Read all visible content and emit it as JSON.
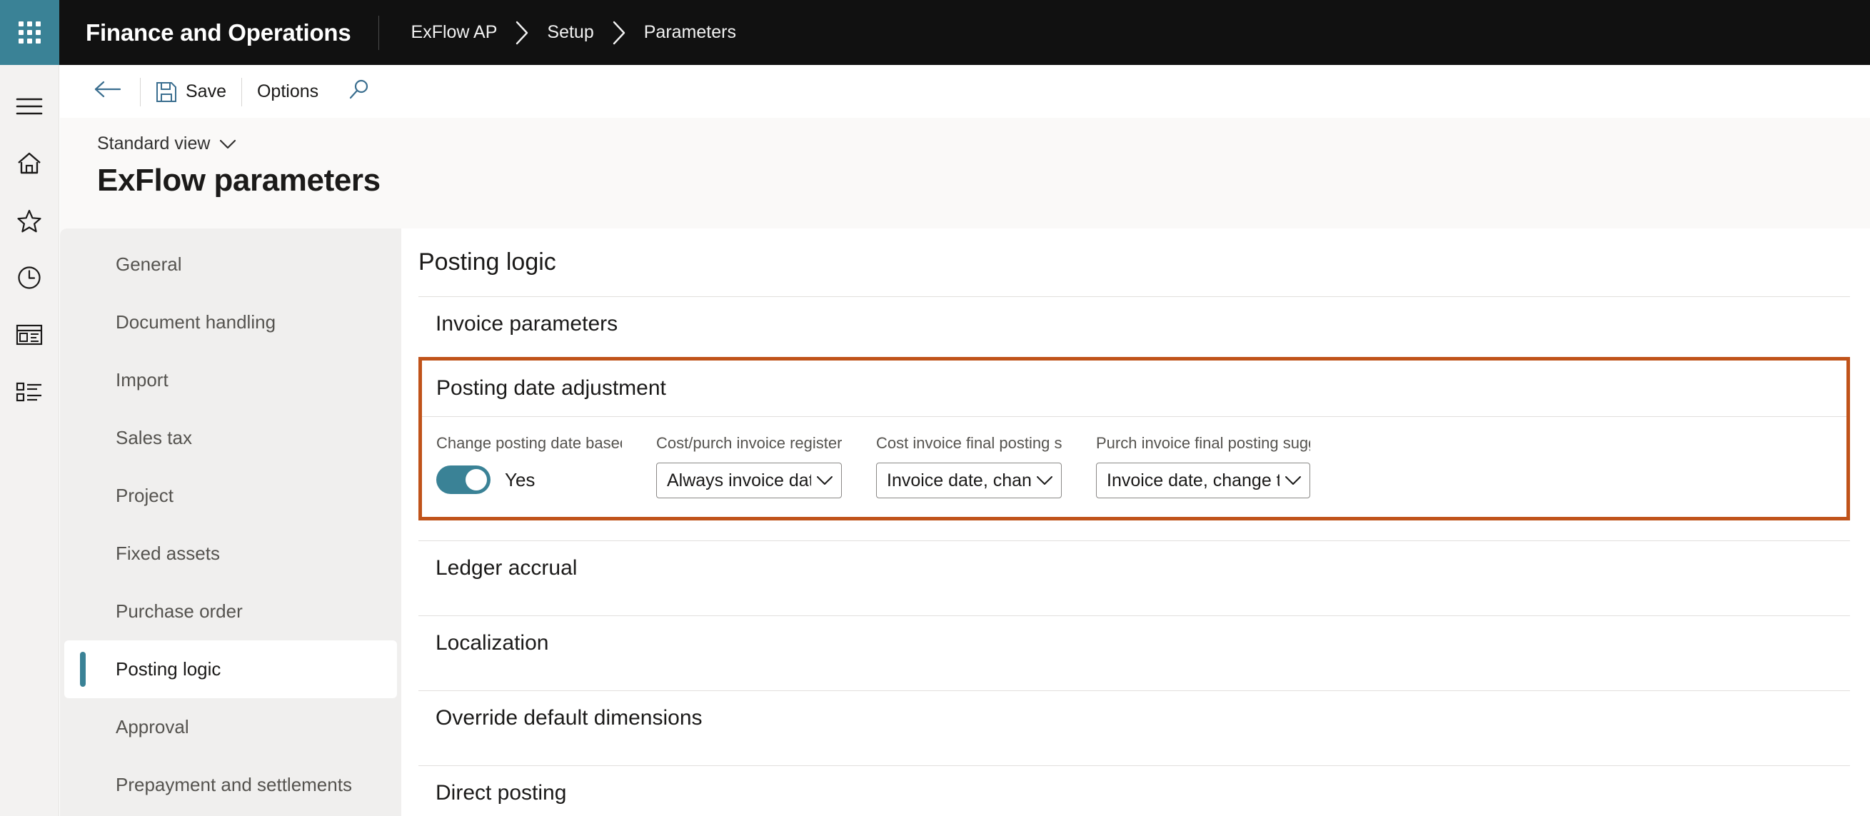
{
  "topbar": {
    "waffle_icon": "app-launcher-icon",
    "app_title": "Finance and Operations",
    "breadcrumb": [
      "ExFlow AP",
      "Setup",
      "Parameters"
    ]
  },
  "rail": {
    "items": [
      {
        "icon": "hamburger-menu-icon",
        "name": "navigation-menu"
      },
      {
        "icon": "home-icon",
        "name": "home"
      },
      {
        "icon": "star-icon",
        "name": "favorites"
      },
      {
        "icon": "clock-icon",
        "name": "recent"
      },
      {
        "icon": "workspace-icon",
        "name": "workspaces"
      },
      {
        "icon": "list-icon",
        "name": "modules"
      }
    ]
  },
  "commandbar": {
    "back_icon": "back-arrow-icon",
    "save_icon": "save-disk-icon",
    "save_label": "Save",
    "options_label": "Options",
    "search_icon": "search-icon"
  },
  "page": {
    "view_label": "Standard view",
    "view_caret_icon": "chevron-down-icon",
    "title": "ExFlow parameters"
  },
  "sectnav": {
    "items": [
      {
        "label": "General",
        "active": false
      },
      {
        "label": "Document handling",
        "active": false
      },
      {
        "label": "Import",
        "active": false
      },
      {
        "label": "Sales tax",
        "active": false
      },
      {
        "label": "Project",
        "active": false
      },
      {
        "label": "Fixed assets",
        "active": false
      },
      {
        "label": "Purchase order",
        "active": false
      },
      {
        "label": "Posting logic",
        "active": true
      },
      {
        "label": "Approval",
        "active": false
      },
      {
        "label": "Prepayment and settlements",
        "active": false
      }
    ]
  },
  "main": {
    "title": "Posting logic",
    "section_invoice_parameters": "Invoice parameters",
    "highlighted": {
      "header": "Posting date adjustment",
      "border_color": "#c0531a",
      "fields": [
        {
          "label": "Change posting date based on modul...",
          "type": "toggle",
          "value": "Yes",
          "on": true,
          "accent": "#3a8296"
        },
        {
          "label": "Cost/purch invoice register suggested ...",
          "type": "dropdown",
          "value": "Always invoice date"
        },
        {
          "label": "Cost invoice final posting suggested p...",
          "type": "dropdown",
          "value": "Invoice date, change to first o..."
        },
        {
          "label": "Purch invoice final posting suggested ...",
          "type": "dropdown",
          "value": "Invoice date, change to first o..."
        }
      ]
    },
    "sections_below": [
      "Ledger accrual",
      "Localization",
      "Override default dimensions",
      "Direct posting"
    ]
  }
}
